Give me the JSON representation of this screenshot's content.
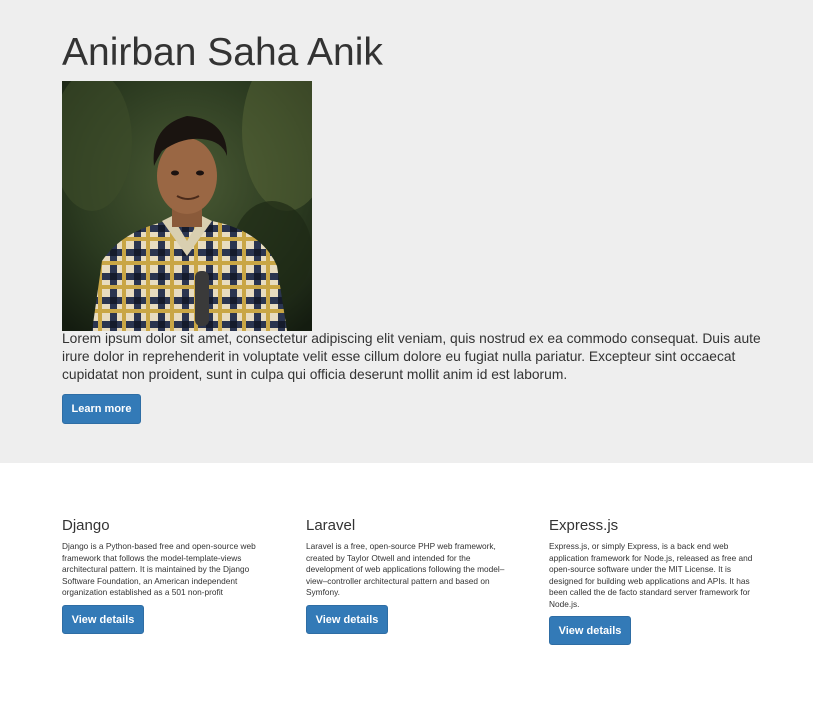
{
  "hero": {
    "title": "Anirban Saha Anik",
    "paragraph": "Lorem ipsum dolor sit amet, consectetur adipiscing elit veniam, quis nostrud ex ea commodo consequat. Duis aute irure dolor in reprehenderit in voluptate velit esse cillum dolore eu fugiat nulla pariatur. Excepteur sint occaecat cupidatat non proident, sunt in culpa qui officia deserunt mollit anim id est laborum.",
    "button_label": "Learn more"
  },
  "columns": [
    {
      "title": "Django",
      "text": "Django is a Python-based free and open-source web framework that follows the model-template-views architectural pattern. It is maintained by the Django Software Foundation, an American independent organization established as a 501 non-profit",
      "button_label": "View details"
    },
    {
      "title": "Laravel",
      "text": "Laravel is a free, open-source PHP web framework, created by Taylor Otwell and intended for the development of web applications following the model–view–controller architectural pattern and based on Symfony.",
      "button_label": "View details"
    },
    {
      "title": "Express.js",
      "text": "Express.js, or simply Express, is a back end web application framework for Node.js, released as free and open-source software under the MIT License. It is designed for building web applications and APIs. It has been called the de facto standard server framework for Node.js.",
      "button_label": "View details"
    }
  ],
  "colors": {
    "primary_button": "#337ab7",
    "jumbotron_bg": "#eeeeee",
    "text": "#333333"
  }
}
